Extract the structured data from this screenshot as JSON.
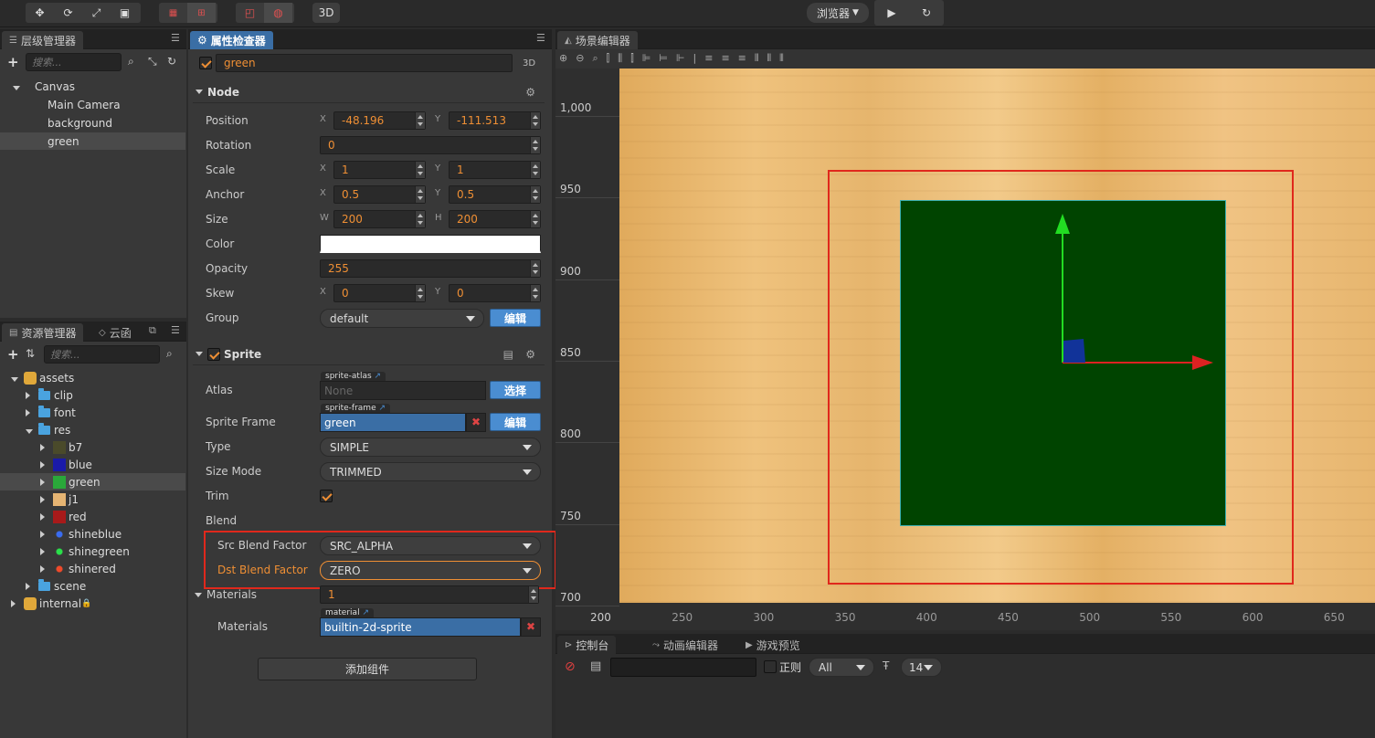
{
  "toolbar": {
    "transform_icons": [
      "move-icon",
      "rotate-icon",
      "scale-icon",
      "rect-icon"
    ],
    "pivot_icons": [
      "pivot-icon",
      "anchor-icon"
    ],
    "coord_icons": [
      "local-icon",
      "global-icon"
    ],
    "mode3d": "3D",
    "browser": "浏览器",
    "play_icon": "play-icon",
    "refresh_icon": "refresh-icon"
  },
  "hierarchy": {
    "title": "层级管理器",
    "search_placeholder": "搜索...",
    "nodes": [
      {
        "label": "Canvas",
        "level": 0,
        "expanded": true,
        "selected": false
      },
      {
        "label": "Main Camera",
        "level": 1,
        "selected": false
      },
      {
        "label": "background",
        "level": 1,
        "selected": false
      },
      {
        "label": "green",
        "level": 1,
        "selected": true
      }
    ]
  },
  "assets": {
    "title": "资源管理器",
    "tab2": "云函",
    "search_placeholder": "搜索...",
    "items": [
      {
        "label": "assets",
        "level": 0,
        "kind": "db",
        "expanded": true
      },
      {
        "label": "clip",
        "level": 1,
        "kind": "folder",
        "expanded": false
      },
      {
        "label": "font",
        "level": 1,
        "kind": "folder",
        "expanded": false
      },
      {
        "label": "res",
        "level": 1,
        "kind": "folder",
        "expanded": true
      },
      {
        "label": "b7",
        "level": 2,
        "kind": "image",
        "color": "#4a4a2a"
      },
      {
        "label": "blue",
        "level": 2,
        "kind": "image",
        "color": "#1a1aa8"
      },
      {
        "label": "green",
        "level": 2,
        "kind": "image",
        "color": "#2aa83a",
        "selected": true
      },
      {
        "label": "j1",
        "level": 2,
        "kind": "image",
        "color": "#e6b573"
      },
      {
        "label": "red",
        "level": 2,
        "kind": "image",
        "color": "#a81a1a"
      },
      {
        "label": "shineblue",
        "level": 2,
        "kind": "dot",
        "color": "#3a6cf0"
      },
      {
        "label": "shinegreen",
        "level": 2,
        "kind": "dot",
        "color": "#2ae04a"
      },
      {
        "label": "shinered",
        "level": 2,
        "kind": "dot",
        "color": "#f04a2a"
      },
      {
        "label": "scene",
        "level": 1,
        "kind": "folder",
        "expanded": false
      },
      {
        "label": "internal",
        "level": 0,
        "kind": "db-locked",
        "expanded": false
      }
    ]
  },
  "inspector": {
    "title": "属性检查器",
    "node_name": "green",
    "mode3d": "3D",
    "node_section": "Node",
    "position": {
      "label": "Position",
      "x": "-48.196",
      "y": "-111.513"
    },
    "rotation": {
      "label": "Rotation",
      "value": "0"
    },
    "scale": {
      "label": "Scale",
      "x": "1",
      "y": "1"
    },
    "anchor": {
      "label": "Anchor",
      "x": "0.5",
      "y": "0.5"
    },
    "size": {
      "label": "Size",
      "w": "200",
      "h": "200"
    },
    "color": {
      "label": "Color",
      "value": "#ffffff"
    },
    "opacity": {
      "label": "Opacity",
      "value": "255"
    },
    "skew": {
      "label": "Skew",
      "x": "0",
      "y": "0"
    },
    "group": {
      "label": "Group",
      "value": "default",
      "button": "编辑"
    },
    "axis_x": "X",
    "axis_y": "Y",
    "axis_w": "W",
    "axis_h": "H",
    "sprite_section": "Sprite",
    "atlas": {
      "label": "Atlas",
      "tag": "sprite-atlas",
      "value": "None",
      "button": "选择"
    },
    "sprite_frame": {
      "label": "Sprite Frame",
      "tag": "sprite-frame",
      "value": "green",
      "button": "编辑"
    },
    "type": {
      "label": "Type",
      "value": "SIMPLE"
    },
    "size_mode": {
      "label": "Size Mode",
      "value": "TRIMMED"
    },
    "trim": {
      "label": "Trim",
      "checked": true
    },
    "blend": {
      "label": "Blend"
    },
    "src_blend": {
      "label": "Src Blend Factor",
      "value": "SRC_ALPHA"
    },
    "dst_blend": {
      "label": "Dst Blend Factor",
      "value": "ZERO"
    },
    "materials": {
      "label": "Materials",
      "count": "1",
      "item_label": "Materials",
      "tag": "material",
      "value": "builtin-2d-sprite"
    },
    "add_component": "添加组件"
  },
  "scene": {
    "title": "场景编辑器",
    "ruler_y": [
      "1,000",
      "950",
      "900",
      "850",
      "800",
      "750",
      "700"
    ],
    "ruler_x": [
      "200",
      "250",
      "300",
      "350",
      "400",
      "450",
      "500",
      "550",
      "600",
      "650"
    ],
    "sprite_color": "#004400",
    "background_color": "#e8b76c"
  },
  "console": {
    "tabs": [
      "控制台",
      "动画编辑器",
      "游戏预览"
    ],
    "regex_label": "正则",
    "filter_value": "All",
    "font_size": "14"
  }
}
